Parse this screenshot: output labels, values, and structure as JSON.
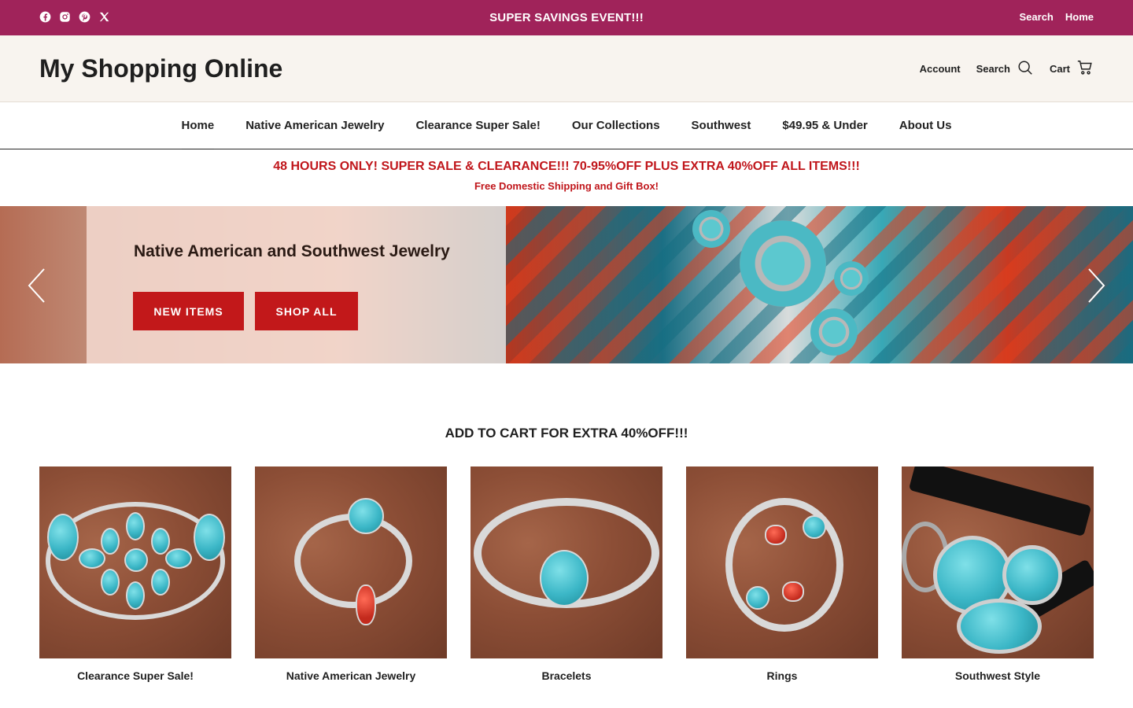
{
  "announcement": {
    "text": "SUPER SAVINGS EVENT!!!",
    "links": {
      "search": "Search",
      "home": "Home"
    },
    "socials": [
      "facebook-icon",
      "instagram-icon",
      "pinterest-icon",
      "x-icon"
    ],
    "bg_color": "#a0235a"
  },
  "header": {
    "logo": "My Shopping Online",
    "account": "Account",
    "search": "Search",
    "cart": "Cart",
    "bg_color": "#f8f4ef"
  },
  "nav": {
    "items": [
      "Home",
      "Native American Jewelry",
      "Clearance Super Sale!",
      "Our Collections",
      "Southwest",
      "$49.95 & Under",
      "About Us"
    ],
    "active": "Home"
  },
  "promo": {
    "line1": "48 HOURS ONLY! SUPER SALE & CLEARANCE!!! 70-95%OFF PLUS EXTRA 40%OFF ALL ITEMS!!!",
    "line2": "Free Domestic Shipping and Gift Box!",
    "color": "#c0161b"
  },
  "hero": {
    "title": "Native American and Southwest Jewelry",
    "buttons": {
      "new": "NEW ITEMS",
      "all": "SHOP ALL"
    },
    "button_color": "#c2181a"
  },
  "section": {
    "title": "ADD TO CART FOR EXTRA 40%OFF!!!",
    "collections": [
      {
        "label": "Clearance Super Sale!"
      },
      {
        "label": "Native American Jewelry"
      },
      {
        "label": "Bracelets"
      },
      {
        "label": "Rings"
      },
      {
        "label": "Southwest Style"
      }
    ]
  }
}
